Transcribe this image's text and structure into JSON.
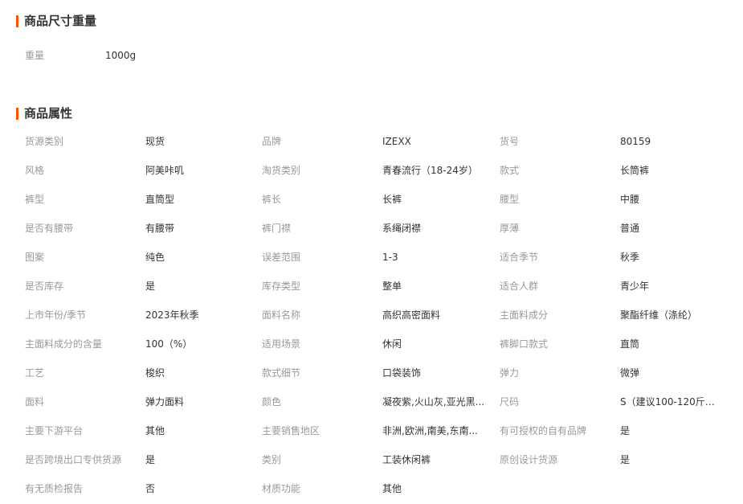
{
  "size_section": {
    "title": "商品尺寸重量",
    "weight_label": "重量",
    "weight_value": "1000g"
  },
  "attr_section": {
    "title": "商品属性",
    "rows": [
      [
        [
          "货源类别",
          "现货"
        ],
        [
          "品牌",
          "IZEXX"
        ],
        [
          "货号",
          "80159"
        ]
      ],
      [
        [
          "风格",
          "阿美咔叽"
        ],
        [
          "淘货类别",
          "青春流行（18-24岁）"
        ],
        [
          "款式",
          "长筒裤"
        ]
      ],
      [
        [
          "裤型",
          "直筒型"
        ],
        [
          "裤长",
          "长裤"
        ],
        [
          "腰型",
          "中腰"
        ]
      ],
      [
        [
          "是否有腰带",
          "有腰带"
        ],
        [
          "裤门襟",
          "系绳闭襟"
        ],
        [
          "厚薄",
          "普通"
        ]
      ],
      [
        [
          "图案",
          "纯色"
        ],
        [
          "误差范围",
          "1-3"
        ],
        [
          "适合季节",
          "秋季"
        ]
      ],
      [
        [
          "是否库存",
          "是"
        ],
        [
          "库存类型",
          "整单"
        ],
        [
          "适合人群",
          "青少年"
        ]
      ],
      [
        [
          "上市年份/季节",
          "2023年秋季"
        ],
        [
          "面料名称",
          "高织高密面料"
        ],
        [
          "主面料成分",
          "聚酯纤维（涤纶）"
        ]
      ],
      [
        [
          "主面料成分的含量",
          "100（%）"
        ],
        [
          "适用场景",
          "休闲"
        ],
        [
          "裤脚口款式",
          "直筒"
        ]
      ],
      [
        [
          "工艺",
          "梭织"
        ],
        [
          "款式细节",
          "口袋装饰"
        ],
        [
          "弹力",
          "微弹"
        ]
      ],
      [
        [
          "面料",
          "弹力面料"
        ],
        [
          "颜色",
          "凝夜紫,火山灰,亚光黑..."
        ],
        [
          "尺码",
          "S（建议100-120斤）,..."
        ]
      ],
      [
        [
          "主要下游平台",
          "其他"
        ],
        [
          "主要销售地区",
          "非洲,欧洲,南美,东南..."
        ],
        [
          "有可授权的自有品牌",
          "是"
        ]
      ],
      [
        [
          "是否跨境出口专供货源",
          "是"
        ],
        [
          "类别",
          "工装休闲裤"
        ],
        [
          "原创设计货源",
          "是"
        ]
      ],
      [
        [
          "有无质检报告",
          "否"
        ],
        [
          "材质功能",
          "其他"
        ]
      ]
    ]
  }
}
